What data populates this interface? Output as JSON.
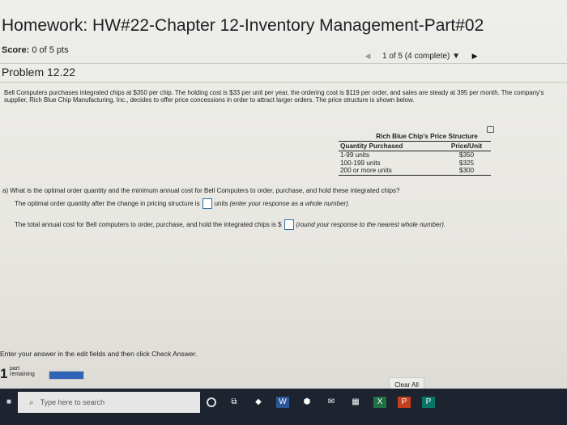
{
  "header": {
    "title": "Homework: HW#22-Chapter 12-Inventory Management-Part#02",
    "score_label": "Score:",
    "score_value": "0 of 5 pts",
    "nav_position": "1 of 5 (4 complete)"
  },
  "problem": {
    "name": "Problem 12.22",
    "text": "Bell Computers purchases integrated chips at $350 per chip. The holding cost is $33 per unit per year, the ordering cost is $119 per order, and sales are steady at 395 per month. The company's supplier, Rich Blue Chip Manufacturing, Inc., decides to offer price concessions in order to attract larger orders. The price structure is shown below."
  },
  "price_table": {
    "caption": "Rich Blue Chip's Price Structure",
    "headers": [
      "Quantity Purchased",
      "Price/Unit"
    ],
    "rows": [
      [
        "1-99 units",
        "$350"
      ],
      [
        "100-199 units",
        "$325"
      ],
      [
        "200 or more units",
        "$300"
      ]
    ]
  },
  "question": {
    "a_text": "a) What is the optimal order quantity and the minimum annual cost for Bell Computers to order, purchase, and hold these integrated chips?",
    "line1_pre": "The optimal order quantity after the change in pricing structure is",
    "line1_post": "units",
    "line1_hint": "(enter your response as a whole number).",
    "line2_pre": "The total annual cost for Bell computers to order, purchase, and hold the integrated chips is $",
    "line2_hint": "(round your response to the nearest whole number)."
  },
  "footer": {
    "instruction": "Enter your answer in the edit fields and then click Check Answer.",
    "parts_count": "1",
    "parts_label_1": "part",
    "parts_label_2": "remaining",
    "clear_label": "Clear All"
  },
  "taskbar": {
    "search_placeholder": "Type here to search"
  }
}
